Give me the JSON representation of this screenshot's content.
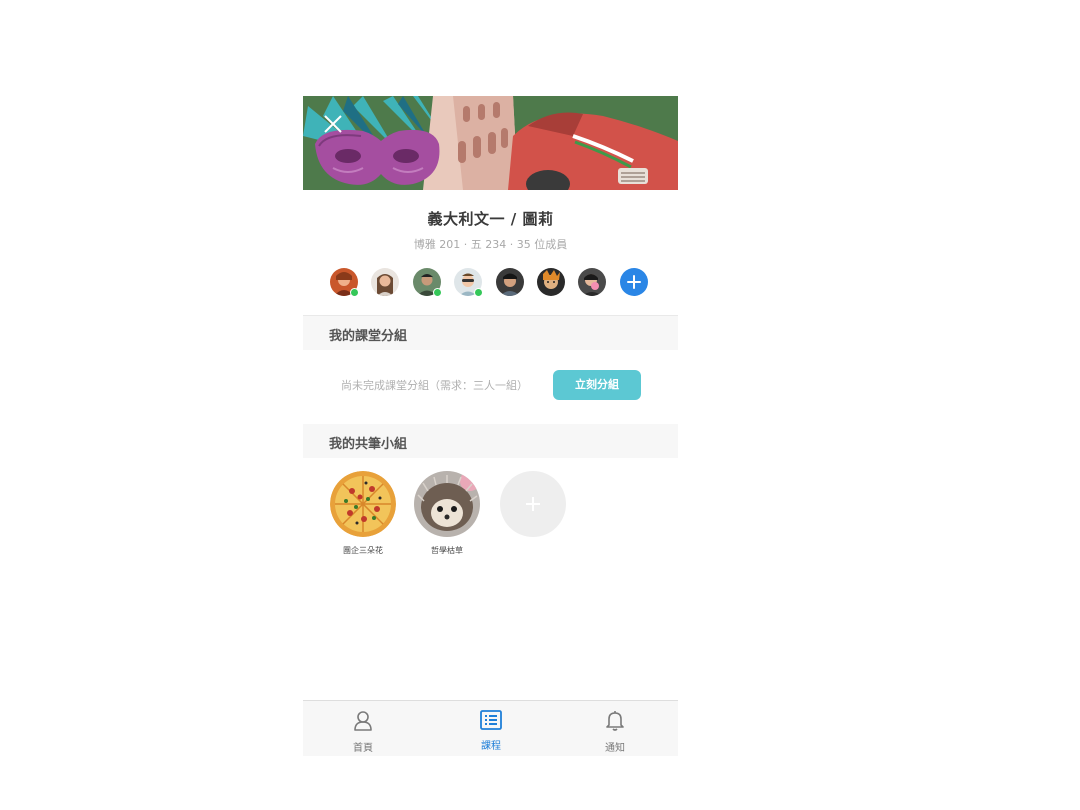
{
  "course": {
    "title": "義大利文一 / 圖莉",
    "meta": "博雅 201 · 五 234 · 35 位成員"
  },
  "members": [
    {
      "name": "member-1",
      "online": true
    },
    {
      "name": "member-2",
      "online": false
    },
    {
      "name": "member-3",
      "online": true
    },
    {
      "name": "member-4",
      "online": true
    },
    {
      "name": "member-5",
      "online": false
    },
    {
      "name": "member-6",
      "online": false
    },
    {
      "name": "member-7",
      "online": false
    }
  ],
  "class_group": {
    "header": "我的課堂分組",
    "note": "尚未完成課堂分組（需求：三人一組）",
    "button": "立刻分組"
  },
  "notebooks": {
    "header": "我的共筆小組",
    "items": [
      {
        "label": "團企三朵花",
        "icon": "pizza-image"
      },
      {
        "label": "哲學枯草",
        "icon": "hedgehog-image"
      }
    ]
  },
  "tabbar": {
    "items": [
      {
        "label": "首頁",
        "icon": "user-icon",
        "active": false
      },
      {
        "label": "課程",
        "icon": "list-icon",
        "active": true
      },
      {
        "label": "通知",
        "icon": "bell-icon",
        "active": false
      }
    ]
  },
  "colors": {
    "accent": "#1f7fd8",
    "button": "#5cc8d3",
    "online": "#35c759",
    "add_member": "#2a86e6"
  }
}
